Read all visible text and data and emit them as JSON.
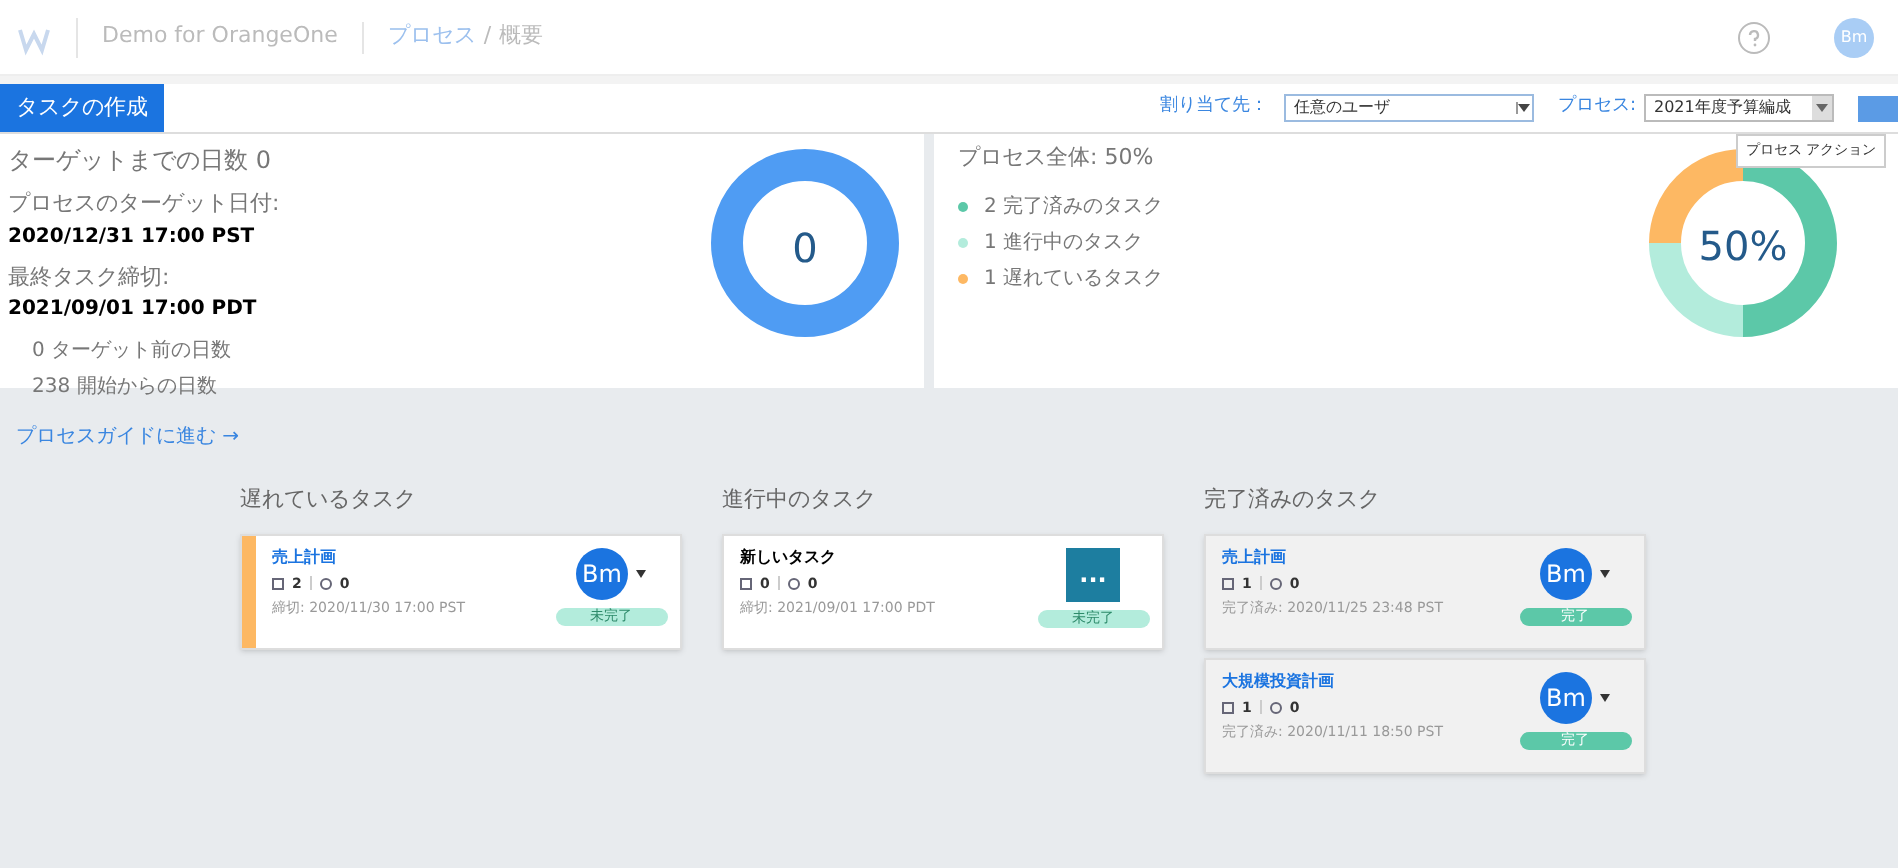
{
  "header": {
    "app": "Demo for OrangeOne",
    "breadcrumb_link": "プロセス",
    "breadcrumb_sep": "/",
    "breadcrumb_current": "概要",
    "avatar": "Bm"
  },
  "toolbar": {
    "create_button": "タスクの作成",
    "assignee_label": "割り当て先：",
    "assignee_value": "任意のユーザ",
    "process_label": "プロセス:",
    "process_value": "2021年度予算編成",
    "tooltip": "プロセス アクション"
  },
  "target_panel": {
    "days_to_target": "ターゲットまでの日数 0",
    "target_date_label": "プロセスのターゲット日付:",
    "target_date": "2020/12/31 17:00 PST",
    "last_deadline_label": "最終タスク締切:",
    "last_deadline": "2021/09/01 17:00 PDT",
    "stats": [
      "0 ターゲット前の日数",
      "238 開始からの日数"
    ],
    "donut_value": "0"
  },
  "progress_panel": {
    "title": "プロセス全体: 50%",
    "donut_value": "50%",
    "legend": [
      {
        "count": "2",
        "label": "完了済みのタスク",
        "color": "#5cc8a8"
      },
      {
        "count": "1",
        "label": "進行中のタスク",
        "color": "#b3ecdc"
      },
      {
        "count": "1",
        "label": "遅れているタスク",
        "color": "#fdb863"
      }
    ]
  },
  "guide_link": "プロセスガイドに進む →",
  "columns": [
    {
      "title": "遅れているタスク",
      "cards": [
        {
          "kind": "overdue",
          "title": "売上計画",
          "comments": "2",
          "attachments": "0",
          "date": "締切: 2020/11/30 17:00 PST",
          "avatar": "Bm",
          "status": "未完了"
        }
      ]
    },
    {
      "title": "進行中のタスク",
      "cards": [
        {
          "kind": "active",
          "title": "新しいタスク",
          "comments": "0",
          "attachments": "0",
          "date": "締切: 2021/09/01 17:00 PDT",
          "avatar": "...",
          "status": "未完了"
        }
      ]
    },
    {
      "title": "完了済みのタスク",
      "cards": [
        {
          "kind": "done",
          "title": "売上計画",
          "comments": "1",
          "attachments": "0",
          "date": "完了済み: 2020/11/25 23:48 PST",
          "avatar": "Bm",
          "status": "完了"
        },
        {
          "kind": "done",
          "title": "大規模投資計画",
          "comments": "1",
          "attachments": "0",
          "date": "完了済み: 2020/11/11 18:50 PST",
          "avatar": "Bm",
          "status": "完了"
        }
      ]
    }
  ]
}
